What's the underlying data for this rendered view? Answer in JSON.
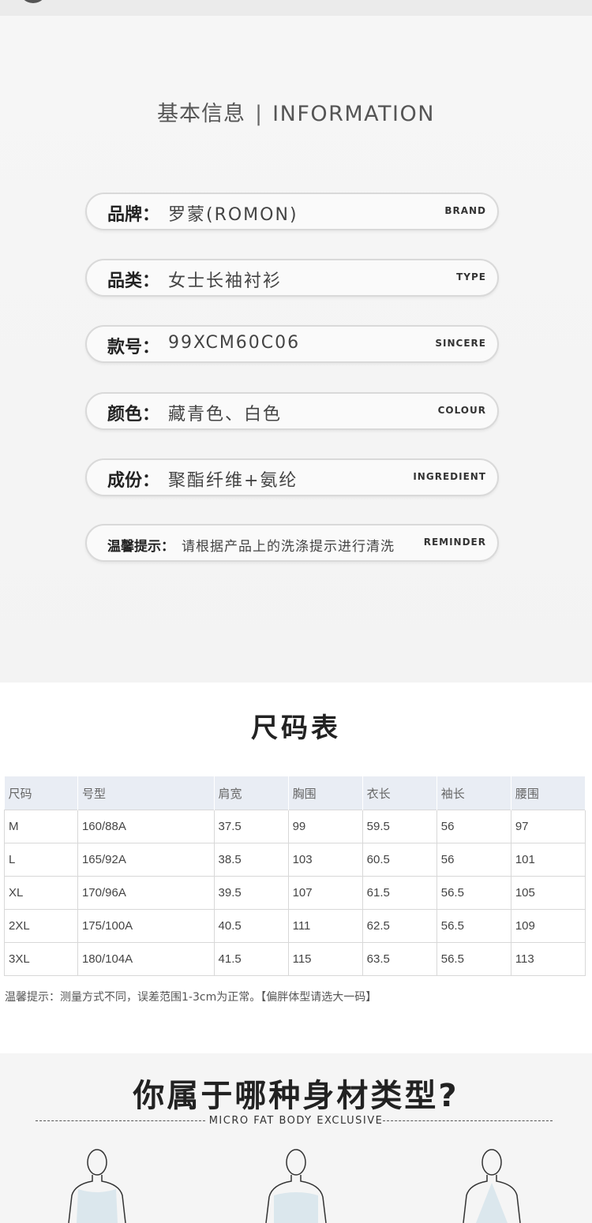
{
  "info": {
    "title_cn": "基本信息",
    "separator": "|",
    "title_en": "INFORMATION",
    "rows": [
      {
        "label": "品牌：",
        "value": "罗蒙(ROMON)",
        "en": "BRAND"
      },
      {
        "label": "品类：",
        "value": "女士长袖衬衫",
        "en": "TYPE"
      },
      {
        "label": "款号：",
        "value": "99XCM60C06",
        "en": "SINCERE"
      },
      {
        "label": "颜色：",
        "value": "藏青色、白色",
        "en": "COLOUR"
      },
      {
        "label": "成份：",
        "value": "聚酯纤维+氨纶",
        "en": "INGREDIENT"
      },
      {
        "label": "温馨提示：",
        "value": "请根据产品上的洗涤提示进行清洗",
        "en": "REMINDER"
      }
    ]
  },
  "size_chart": {
    "title": "尺码表",
    "headers": [
      "尺码",
      "号型",
      "肩宽",
      "胸围",
      "衣长",
      "袖长",
      "腰围"
    ],
    "rows": [
      [
        "M",
        "160/88A",
        "37.5",
        "99",
        "59.5",
        "56",
        "97"
      ],
      [
        "L",
        "165/92A",
        "38.5",
        "103",
        "60.5",
        "56",
        "101"
      ],
      [
        "XL",
        "170/96A",
        "39.5",
        "107",
        "61.5",
        "56.5",
        "105"
      ],
      [
        "2XL",
        "175/100A",
        "40.5",
        "111",
        "62.5",
        "56.5",
        "109"
      ],
      [
        "3XL",
        "180/104A",
        "41.5",
        "115",
        "63.5",
        "56.5",
        "113"
      ]
    ],
    "note": "温馨提示：测量方式不同，误差范围1-3cm为正常。【偏胖体型请选大一码】"
  },
  "body_type": {
    "title": "你属于哪种身材类型?",
    "subtitle": "MICRO FAT BODY EXCLUSIVE"
  },
  "colors": {
    "pill_border": "#d9d9d9",
    "table_header_bg": "#e9edf4",
    "figure_fill": "#c9dde8"
  }
}
